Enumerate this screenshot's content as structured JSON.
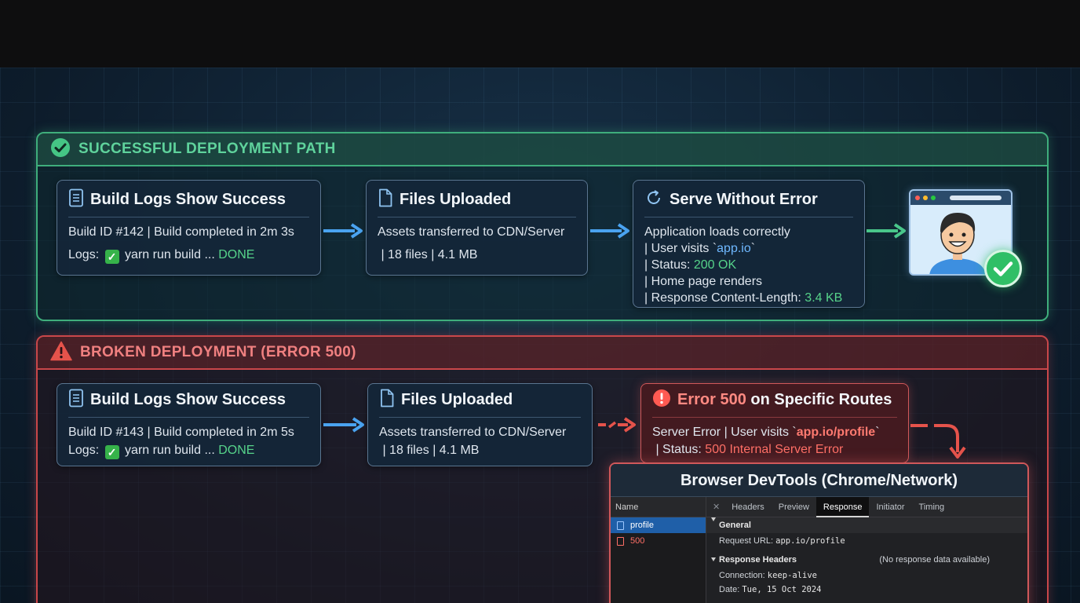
{
  "success_section": {
    "title": "SUCCESSFUL DEPLOYMENT PATH",
    "build_card": {
      "title": "Build Logs Show Success",
      "line1": "Build ID #142 | Build completed in 2m 3s",
      "logs_prefix": "Logs:",
      "logs_text": "yarn run build ...",
      "logs_status": "DONE"
    },
    "upload_card": {
      "title": "Files Uploaded",
      "line1": "Assets transferred to CDN/Server",
      "line2": " | 18 files | 4.1 MB"
    },
    "serve_card": {
      "title": "Serve Without Error",
      "line1": "Application loads correctly",
      "visits_prefix": "| User visits `",
      "visits_url": "app.io",
      "visits_suffix": "`",
      "status_prefix": "| Status: ",
      "status_value": "200 OK",
      "line4": "| Home page renders",
      "length_prefix": "| Response Content-Length: ",
      "length_value": "3.4 KB"
    }
  },
  "broken_section": {
    "title": "BROKEN DEPLOYMENT (ERROR 500)",
    "build_card": {
      "title": "Build Logs Show Success",
      "line1": "Build ID #143 | Build completed in 2m 5s",
      "logs_prefix": "Logs:",
      "logs_text": "yarn run build ...",
      "logs_status": "DONE"
    },
    "upload_card": {
      "title": "Files Uploaded",
      "line1": "Assets transferred to CDN/Server",
      "line2": " | 18 files | 4.1 MB"
    },
    "error_card": {
      "title_red": "Error 500",
      "title_rest": " on Specific Routes",
      "visits_prefix": "Server Error | User visits `",
      "visits_url": "app.io/profile",
      "visits_suffix": "`",
      "status_prefix": " | Status: ",
      "status_value": "500 Internal Server Error"
    }
  },
  "devtools": {
    "title": "Browser DevTools (Chrome/Network)",
    "name_header": "Name",
    "requests": [
      "profile",
      "500"
    ],
    "close_glyph": "✕",
    "tabs": [
      "Headers",
      "Preview",
      "Response",
      "Initiator",
      "Timing"
    ],
    "active_tab": "Response",
    "general_label": "General",
    "request_url_label": "Request URL:",
    "request_url": "app.io/profile",
    "response_headers_label": "Response Headers",
    "no_data": "(No response data available)",
    "connection_label": "Connection:",
    "connection_value": "keep-alive",
    "date_label": "Date:",
    "date_value": "Tue, 15 Oct 2024"
  },
  "colors": {
    "success": "#3fae7c",
    "error": "#c9474a",
    "arrow_blue": "#4aa3f0",
    "arrow_green": "#49c68a",
    "arrow_red": "#e5534b"
  },
  "icons": [
    "check-circle-icon",
    "warning-triangle-icon",
    "document-icon",
    "file-icon",
    "refresh-icon",
    "error-circle-icon",
    "arrow-right-icon",
    "user-avatar-icon",
    "success-check-icon"
  ]
}
